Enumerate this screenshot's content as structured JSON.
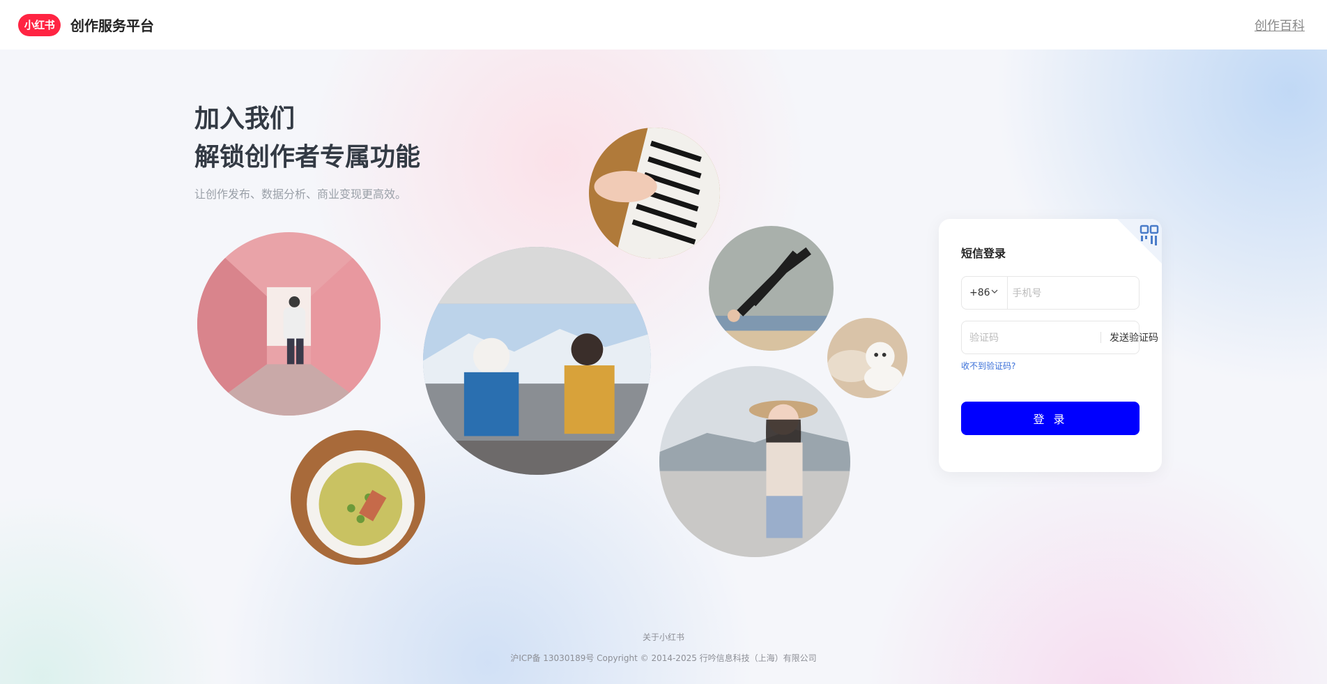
{
  "header": {
    "logo_text": "小红书",
    "title": "创作服务平台",
    "right_link": "创作百科"
  },
  "hero": {
    "line1": "加入我们",
    "line2": "解锁创作者专属功能",
    "subtitle": "让创作发布、数据分析、商业变现更高效。"
  },
  "login": {
    "title": "短信登录",
    "country_code": "+86",
    "phone_placeholder": "手机号",
    "code_placeholder": "验证码",
    "send_code": "发送验证码",
    "help": "收不到验证码?",
    "submit": "登 录"
  },
  "footer": {
    "about": "关于小红书",
    "icp": "沪ICP备 13030189号 Copyright © 2014-2025 行吟信息科技（上海）有限公司"
  },
  "colors": {
    "brand": "#ff2442",
    "primary": "#0000ff",
    "link": "#3a6fd8"
  }
}
